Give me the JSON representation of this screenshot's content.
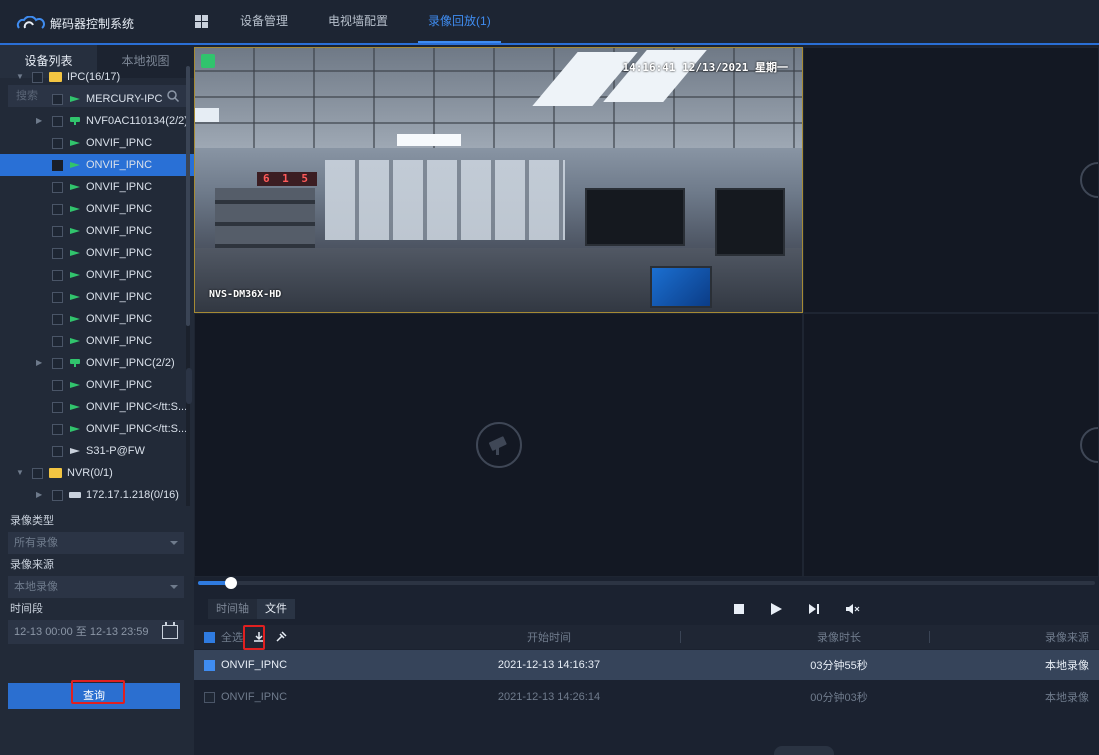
{
  "app": {
    "title": "解码器控制系统"
  },
  "nav": {
    "items": [
      "设备管理",
      "电视墙配置",
      "录像回放(1)"
    ]
  },
  "sidebar": {
    "tabs": [
      "设备列表",
      "本地视图"
    ],
    "search_placeholder": "搜索",
    "tree": [
      {
        "label": "IPC(16/17)",
        "type": "folder",
        "level": 0,
        "expanded": true
      },
      {
        "label": "MERCURY-IPC",
        "type": "camera",
        "level": 1
      },
      {
        "label": "NVF0AC110134(2/2)",
        "type": "group",
        "level": 1,
        "collapsed": true
      },
      {
        "label": "ONVIF_IPNC",
        "type": "camera",
        "level": 1
      },
      {
        "label": "ONVIF_IPNC",
        "type": "camera",
        "level": 1,
        "selected": true
      },
      {
        "label": "ONVIF_IPNC",
        "type": "camera",
        "level": 1
      },
      {
        "label": "ONVIF_IPNC",
        "type": "camera",
        "level": 1
      },
      {
        "label": "ONVIF_IPNC",
        "type": "camera",
        "level": 1
      },
      {
        "label": "ONVIF_IPNC",
        "type": "camera",
        "level": 1
      },
      {
        "label": "ONVIF_IPNC",
        "type": "camera",
        "level": 1
      },
      {
        "label": "ONVIF_IPNC",
        "type": "camera",
        "level": 1
      },
      {
        "label": "ONVIF_IPNC",
        "type": "camera",
        "level": 1
      },
      {
        "label": "ONVIF_IPNC",
        "type": "camera",
        "level": 1
      },
      {
        "label": "ONVIF_IPNC(2/2)",
        "type": "group",
        "level": 1,
        "collapsed": true
      },
      {
        "label": "ONVIF_IPNC",
        "type": "camera",
        "level": 1
      },
      {
        "label": "ONVIF_IPNC</tt:S...",
        "type": "camera",
        "level": 1
      },
      {
        "label": "ONVIF_IPNC</tt:S...",
        "type": "camera",
        "level": 1
      },
      {
        "label": "S31-P@FW",
        "type": "camera-offline",
        "level": 1
      },
      {
        "label": "NVR(0/1)",
        "type": "folder",
        "level": 0,
        "expanded": true
      },
      {
        "label": "172.17.1.218(0/16)",
        "type": "nvr",
        "level": 1,
        "collapsed": true
      }
    ],
    "filters": {
      "record_type_label": "录像类型",
      "record_type_value": "所有录像",
      "record_source_label": "录像来源",
      "record_source_value": "本地录像",
      "time_range_label": "时间段",
      "time_range_value": "12-13 00:00 至 12-13 23:59"
    },
    "query_button": "查询"
  },
  "video": {
    "osd_time": "14:16:41 12/13/2021 星期一",
    "osd_name": "NVS-DM36X-HD",
    "sign_number": "6 1 5"
  },
  "playback": {
    "tabs": [
      "时间轴",
      "文件"
    ],
    "active_tab": "文件",
    "progress": 0.03,
    "select_all_label": "全选",
    "columns": [
      "开始时间",
      "录像时长",
      "录像来源"
    ],
    "rows": [
      {
        "name": "ONVIF_IPNC",
        "start": "2021-12-13 14:16:37",
        "duration": "03分钟55秒",
        "source": "本地录像",
        "checked": true
      },
      {
        "name": "ONVIF_IPNC",
        "start": "2021-12-13 14:26:14",
        "duration": "00分钟03秒",
        "source": "本地录像",
        "checked": false
      }
    ]
  },
  "colors": {
    "accent": "#2f7be0",
    "highlight": "#e02020",
    "selected_row": "#2970d6"
  }
}
